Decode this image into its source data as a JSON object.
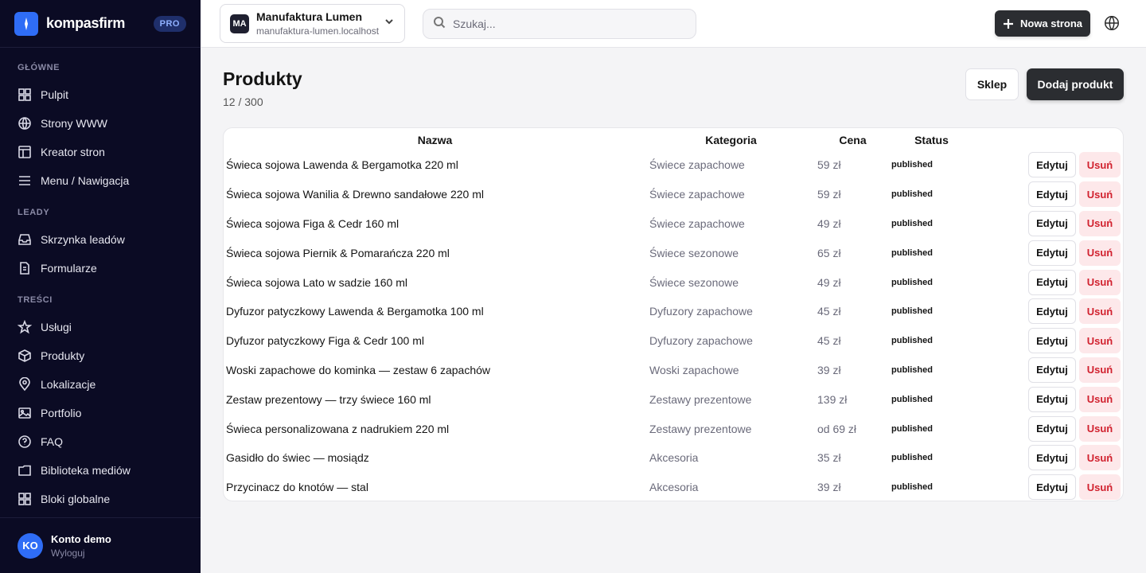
{
  "brand": {
    "name": "kompasfirm",
    "badge": "PRO"
  },
  "sidebar": {
    "sections": [
      {
        "label": "GŁÓWNE",
        "items": [
          {
            "label": "Pulpit",
            "icon": "grid-icon"
          },
          {
            "label": "Strony WWW",
            "icon": "globe-icon"
          },
          {
            "label": "Kreator stron",
            "icon": "layout-icon"
          },
          {
            "label": "Menu / Nawigacja",
            "icon": "menu-icon"
          }
        ]
      },
      {
        "label": "LEADY",
        "items": [
          {
            "label": "Skrzynka leadów",
            "icon": "inbox-icon"
          },
          {
            "label": "Formularze",
            "icon": "document-icon"
          }
        ]
      },
      {
        "label": "TREŚCI",
        "items": [
          {
            "label": "Usługi",
            "icon": "star-icon"
          },
          {
            "label": "Produkty",
            "icon": "box-icon"
          },
          {
            "label": "Lokalizacje",
            "icon": "map-pin-icon"
          },
          {
            "label": "Portfolio",
            "icon": "image-icon"
          },
          {
            "label": "FAQ",
            "icon": "help-icon"
          },
          {
            "label": "Biblioteka mediów",
            "icon": "folder-icon"
          },
          {
            "label": "Bloki globalne",
            "icon": "grid-icon"
          }
        ]
      }
    ],
    "account": {
      "initials": "KO",
      "name": "Konto demo",
      "logout": "Wyloguj"
    }
  },
  "topbar": {
    "site": {
      "initials": "MA",
      "name": "Manufaktura Lumen",
      "domain": "manufaktura-lumen.localhost"
    },
    "search_placeholder": "Szukaj...",
    "new_page": "Nowa strona"
  },
  "main": {
    "title": "Produkty",
    "count": "12 / 300",
    "shop_button": "Sklep",
    "add_button": "Dodaj produkt",
    "columns": {
      "name": "Nazwa",
      "category": "Kategoria",
      "price": "Cena",
      "status": "Status"
    },
    "edit_label": "Edytuj",
    "delete_label": "Usuń",
    "rows": [
      {
        "name": "Świeca sojowa Lawenda & Bergamotka 220 ml",
        "category": "Świece zapachowe",
        "price": "59 zł",
        "status": "published"
      },
      {
        "name": "Świeca sojowa Wanilia & Drewno sandałowe 220 ml",
        "category": "Świece zapachowe",
        "price": "59 zł",
        "status": "published"
      },
      {
        "name": "Świeca sojowa Figa & Cedr 160 ml",
        "category": "Świece zapachowe",
        "price": "49 zł",
        "status": "published"
      },
      {
        "name": "Świeca sojowa Piernik & Pomarańcza 220 ml",
        "category": "Świece sezonowe",
        "price": "65 zł",
        "status": "published"
      },
      {
        "name": "Świeca sojowa Lato w sadzie 160 ml",
        "category": "Świece sezonowe",
        "price": "49 zł",
        "status": "published"
      },
      {
        "name": "Dyfuzor patyczkowy Lawenda & Bergamotka 100 ml",
        "category": "Dyfuzory zapachowe",
        "price": "45 zł",
        "status": "published"
      },
      {
        "name": "Dyfuzor patyczkowy Figa & Cedr 100 ml",
        "category": "Dyfuzory zapachowe",
        "price": "45 zł",
        "status": "published"
      },
      {
        "name": "Woski zapachowe do kominka — zestaw 6 zapachów",
        "category": "Woski zapachowe",
        "price": "39 zł",
        "status": "published"
      },
      {
        "name": "Zestaw prezentowy — trzy świece 160 ml",
        "category": "Zestawy prezentowe",
        "price": "139 zł",
        "status": "published"
      },
      {
        "name": "Świeca personalizowana z nadrukiem 220 ml",
        "category": "Zestawy prezentowe",
        "price": "od 69 zł",
        "status": "published"
      },
      {
        "name": "Gasidło do świec — mosiądz",
        "category": "Akcesoria",
        "price": "35 zł",
        "status": "published"
      },
      {
        "name": "Przycinacz do knotów — stal",
        "category": "Akcesoria",
        "price": "39 zł",
        "status": "published"
      }
    ]
  },
  "colors": {
    "sidebar_bg": "#0b0b24",
    "accent": "#2f6df6",
    "danger": "#d1222f",
    "primary_button": "#2b2d31"
  }
}
